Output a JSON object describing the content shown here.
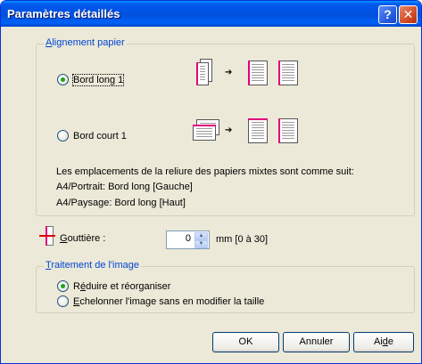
{
  "window": {
    "title": "Paramètres détaillés",
    "help_glyph": "?",
    "close_glyph": "✕"
  },
  "alignment": {
    "group_title_pre": "",
    "group_title_ul": "A",
    "group_title_rest": "lignement papier",
    "options": [
      {
        "label": "Bord long 1",
        "checked": true
      },
      {
        "label": "Bord court 1",
        "checked": false
      }
    ],
    "arrow_glyph": "➔",
    "info_lines": [
      "Les emplacements de la reliure des papiers mixtes sont comme suit:",
      "A4/Portrait: Bord long [Gauche]",
      "A4/Paysage: Bord long [Haut]"
    ]
  },
  "gutter": {
    "label_ul": "G",
    "label_rest": "outtière :",
    "value": "0",
    "unit": "mm [0 à 30]",
    "up_glyph": "▲",
    "down_glyph": "▼"
  },
  "image_processing": {
    "group_title_ul": "T",
    "group_title_rest": "raitement de l'image",
    "options": [
      {
        "label_pre": "R",
        "label_ul": "é",
        "label_rest": "duire et réorganiser",
        "checked": true
      },
      {
        "label_pre": "",
        "label_ul": "E",
        "label_rest": "chelonner l'image sans en modifier la taille",
        "checked": false
      }
    ]
  },
  "buttons": {
    "ok": "OK",
    "cancel": "Annuler",
    "help_pre": "Ai",
    "help_ul": "d",
    "help_rest": "e"
  },
  "colors": {
    "titlebar": "#0054e3",
    "group_title": "#0046d5",
    "binding_edge": "#e0007a"
  }
}
